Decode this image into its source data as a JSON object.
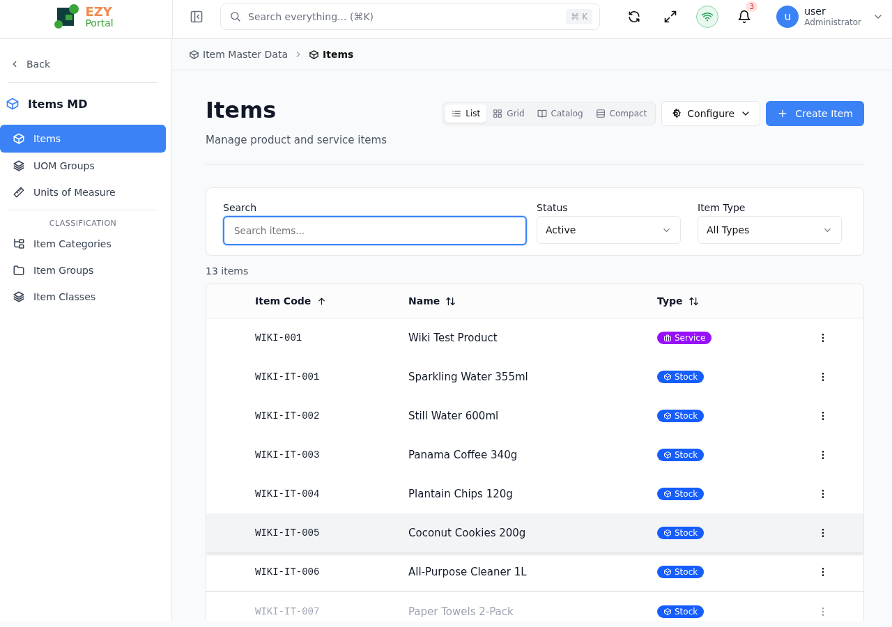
{
  "logo": {
    "line_1": "EZY",
    "line_2": "Portal"
  },
  "header": {
    "search": {
      "placeholder": "Search everything... (⌘K)",
      "shortcut": "⌘ K"
    },
    "notifications": {
      "count": "3"
    },
    "connection": {
      "online": true
    },
    "user": {
      "avatar": "u",
      "name": "user",
      "role": "Administrator"
    }
  },
  "breadcrumb": [
    {
      "label": "Item Master Data",
      "current": false
    },
    {
      "label": "Items",
      "current": true
    }
  ],
  "sidebar": {
    "back": "Back",
    "module": "Items MD",
    "items": [
      {
        "label": "Items",
        "selected": true
      },
      {
        "label": "UOM Groups",
        "selected": false
      },
      {
        "label": "Units of Measure",
        "selected": false
      }
    ],
    "section": "CLASSIFICATION",
    "section_items": [
      {
        "label": "Item Categories",
        "selected": false
      },
      {
        "label": "Item Groups",
        "selected": false
      },
      {
        "label": "Item Classes",
        "selected": false
      }
    ]
  },
  "page": {
    "title": "Items",
    "subtitle": "Manage product and service items",
    "views": [
      {
        "label": "List",
        "selected": true
      },
      {
        "label": "Grid",
        "selected": false
      },
      {
        "label": "Catalog",
        "selected": false
      },
      {
        "label": "Compact",
        "selected": false
      }
    ],
    "configure": "Configure",
    "create": "Create Item"
  },
  "filters": {
    "search": {
      "label": "Search",
      "placeholder": "Search items..."
    },
    "status": {
      "label": "Status",
      "value": "Active"
    },
    "item_type": {
      "label": "Item Type",
      "value": "All Types"
    }
  },
  "count": "13 items",
  "table": {
    "columns": [
      {
        "label": "Item Code",
        "sorted": true
      },
      {
        "label": "Name",
        "sorted": false
      },
      {
        "label": "Type",
        "sorted": false
      }
    ],
    "rows": [
      {
        "code": "WIKI-001",
        "name": "Wiki Test Product",
        "type": {
          "label": "Service",
          "kind": "service",
          "color": "#9810fa"
        },
        "highlighted": false,
        "dimmed": false
      },
      {
        "code": "WIKI-IT-001",
        "name": "Sparkling Water 355ml",
        "type": {
          "label": "Stock",
          "kind": "stock",
          "color": "#155dfc"
        },
        "highlighted": false,
        "dimmed": false
      },
      {
        "code": "WIKI-IT-002",
        "name": "Still Water 600ml",
        "type": {
          "label": "Stock",
          "kind": "stock",
          "color": "#155dfc"
        },
        "highlighted": false,
        "dimmed": false
      },
      {
        "code": "WIKI-IT-003",
        "name": "Panama Coffee 340g",
        "type": {
          "label": "Stock",
          "kind": "stock",
          "color": "#155dfc"
        },
        "highlighted": false,
        "dimmed": false
      },
      {
        "code": "WIKI-IT-004",
        "name": "Plantain Chips 120g",
        "type": {
          "label": "Stock",
          "kind": "stock",
          "color": "#155dfc"
        },
        "highlighted": false,
        "dimmed": false
      },
      {
        "code": "WIKI-IT-005",
        "name": "Coconut Cookies 200g",
        "type": {
          "label": "Stock",
          "kind": "stock",
          "color": "#155dfc"
        },
        "highlighted": true,
        "dimmed": false
      },
      {
        "code": "WIKI-IT-006",
        "name": "All-Purpose Cleaner 1L",
        "type": {
          "label": "Stock",
          "kind": "stock",
          "color": "#155dfc"
        },
        "highlighted": false,
        "dimmed": false
      },
      {
        "code": "WIKI-IT-007",
        "name": "Paper Towels 2-Pack",
        "type": {
          "label": "Stock",
          "kind": "stock",
          "color": "#155dfc"
        },
        "highlighted": false,
        "dimmed": true
      }
    ]
  }
}
